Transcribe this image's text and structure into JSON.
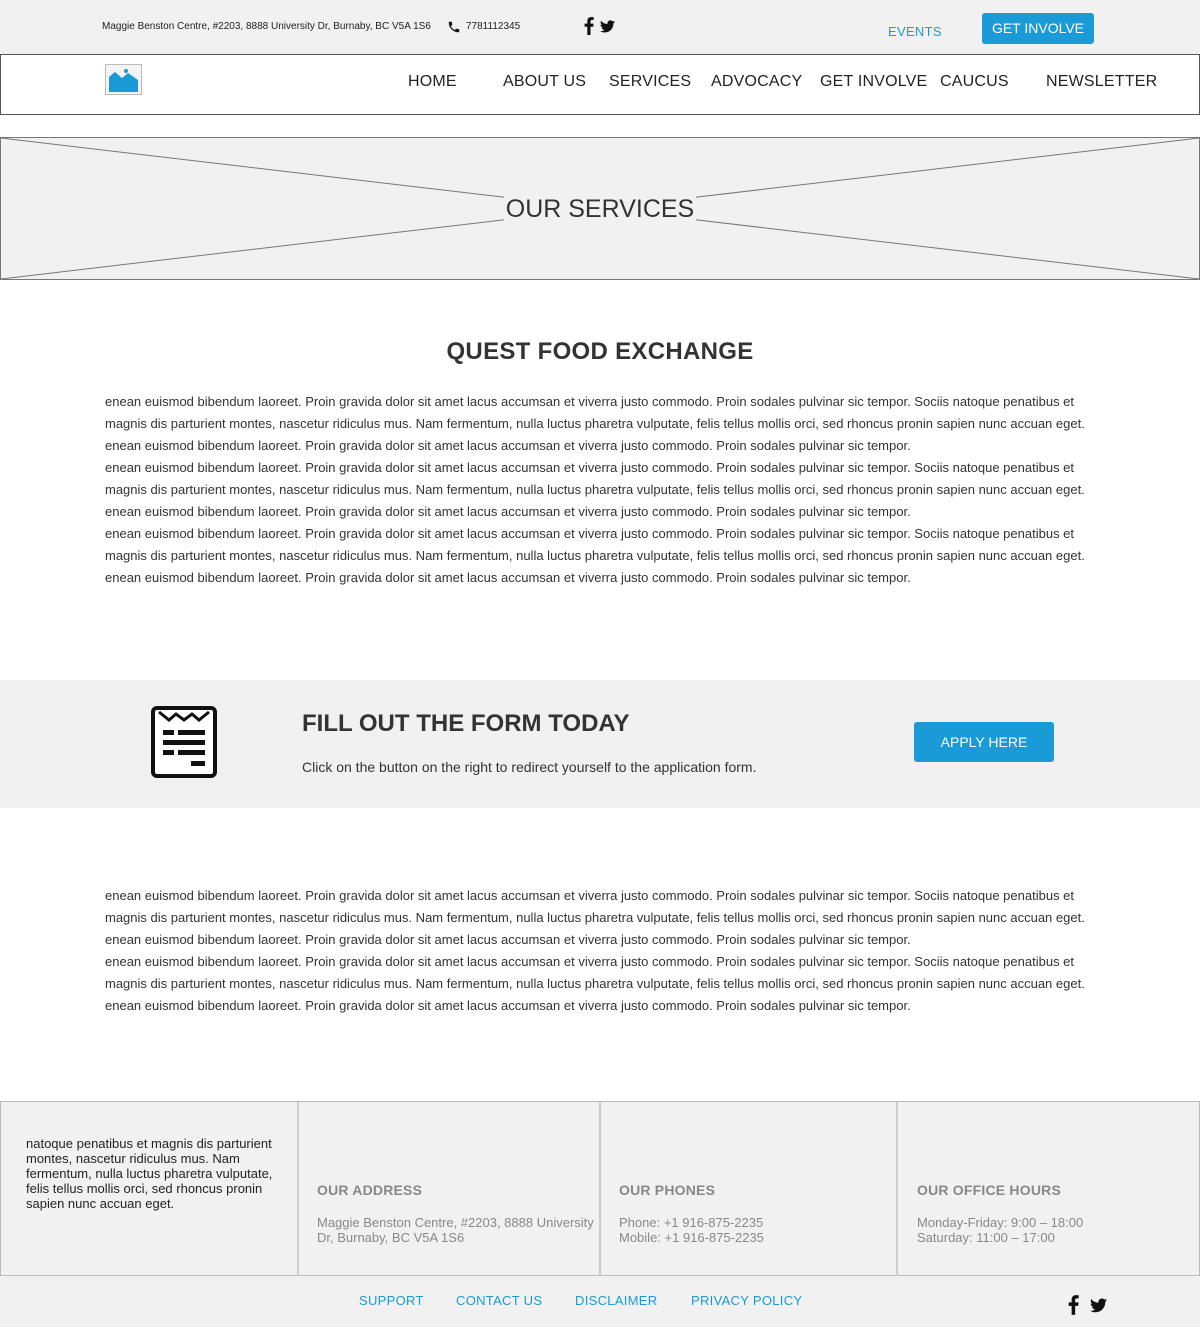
{
  "topbar": {
    "address": "Maggie Benston Centre, #2203, 8888 University Dr, Burnaby, BC V5A 1S6",
    "phone": "7781112345",
    "events_label": "EVENTS",
    "get_involve_label": "GET INVOLVE"
  },
  "nav": {
    "items": [
      {
        "label": "HOME"
      },
      {
        "label": "ABOUT US"
      },
      {
        "label": "SERVICES"
      },
      {
        "label": "ADVOCACY"
      },
      {
        "label": "GET INVOLVE"
      },
      {
        "label": "CAUCUS"
      },
      {
        "label": "NEWSLETTER"
      }
    ]
  },
  "hero": {
    "title": "OUR SERVICES"
  },
  "main": {
    "title": "QUEST FOOD EXCHANGE",
    "paragraph_lines": [
      "enean euismod bibendum laoreet. Proin gravida dolor sit amet lacus accumsan et viverra justo commodo. Proin sodales pulvinar sic tempor. Sociis natoque penatibus et",
      "magnis dis parturient montes, nascetur ridiculus mus. Nam fermentum, nulla luctus pharetra vulputate, felis tellus mollis orci, sed rhoncus pronin sapien nunc accuan eget.",
      "enean euismod bibendum laoreet. Proin gravida dolor sit amet lacus accumsan et viverra justo commodo. Proin sodales pulvinar sic tempor.",
      "enean euismod bibendum laoreet. Proin gravida dolor sit amet lacus accumsan et viverra justo commodo. Proin sodales pulvinar sic tempor. Sociis natoque penatibus et",
      "magnis dis parturient montes, nascetur ridiculus mus. Nam fermentum, nulla luctus pharetra vulputate, felis tellus mollis orci, sed rhoncus pronin sapien nunc accuan eget.",
      "enean euismod bibendum laoreet. Proin gravida dolor sit amet lacus accumsan et viverra justo commodo. Proin sodales pulvinar sic tempor.",
      "enean euismod bibendum laoreet. Proin gravida dolor sit amet lacus accumsan et viverra justo commodo. Proin sodales pulvinar sic tempor. Sociis natoque penatibus et",
      "magnis dis parturient montes, nascetur ridiculus mus. Nam fermentum, nulla luctus pharetra vulputate, felis tellus mollis orci, sed rhoncus pronin sapien nunc accuan eget.",
      "enean euismod bibendum laoreet. Proin gravida dolor sit amet lacus accumsan et viverra justo commodo. Proin sodales pulvinar sic tempor."
    ]
  },
  "cta": {
    "title": "FILL OUT THE FORM TODAY",
    "subtitle": "Click on the button on the right to redirect yourself to the application form.",
    "button_label": "APPLY HERE"
  },
  "second": {
    "paragraph_lines": [
      "enean euismod bibendum laoreet. Proin gravida dolor sit amet lacus accumsan et viverra justo commodo. Proin sodales pulvinar sic tempor. Sociis natoque penatibus et",
      "magnis dis parturient montes, nascetur ridiculus mus. Nam fermentum, nulla luctus pharetra vulputate, felis tellus mollis orci, sed rhoncus pronin sapien nunc accuan eget.",
      "enean euismod bibendum laoreet. Proin gravida dolor sit amet lacus accumsan et viverra justo commodo. Proin sodales pulvinar sic tempor.",
      "enean euismod bibendum laoreet. Proin gravida dolor sit amet lacus accumsan et viverra justo commodo. Proin sodales pulvinar sic tempor. Sociis natoque penatibus et",
      "magnis dis parturient montes, nascetur ridiculus mus. Nam fermentum, nulla luctus pharetra vulputate, felis tellus mollis orci, sed rhoncus pronin sapien nunc accuan eget.",
      "enean euismod bibendum laoreet. Proin gravida dolor sit amet lacus accumsan et viverra justo commodo. Proin sodales pulvinar sic tempor."
    ]
  },
  "footer": {
    "about_text": "natoque penatibus et magnis dis parturient montes, nascetur ridiculus mus. Nam fermentum, nulla luctus pharetra vulputate, felis tellus mollis orci, sed rhoncus pronin sapien nunc accuan eget.",
    "address_heading": "OUR ADDRESS",
    "address_lines": [
      "Maggie Benston Centre, #2203, 8888 University",
      "Dr, Burnaby, BC V5A 1S6"
    ],
    "phones_heading": "OUR PHONES",
    "phone_lines": [
      "Phone: +1 916-875-2235",
      "Mobile: +1 916-875-2235"
    ],
    "hours_heading": "OUR OFFICE HOURS",
    "hours_lines": [
      "Monday-Friday: 9:00 – 18:00",
      "Saturday: 11:00 – 17:00"
    ]
  },
  "bottom_links": {
    "support": "SUPPORT",
    "contact": "CONTACT US",
    "disclaimer": "DISCLAIMER",
    "privacy": "PRIVACY POLICY"
  },
  "icons": {
    "phone": "phone-icon",
    "facebook": "facebook-icon",
    "twitter": "twitter-icon",
    "logo": "image-placeholder-icon",
    "form": "form-document-icon"
  },
  "colors": {
    "accent": "#1a9ad6",
    "band_bg": "#f1f1f1",
    "text": "#333333",
    "muted": "#888888"
  }
}
